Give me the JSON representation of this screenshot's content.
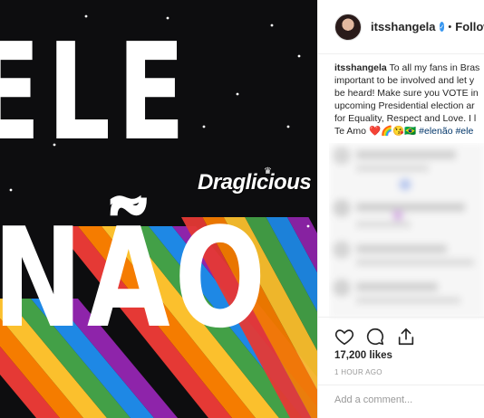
{
  "post_image": {
    "line1": "ELE",
    "line2": "NÃO",
    "tilde": "~",
    "watermark": "Draglicious",
    "crown_icon": "crown-icon",
    "background": "#0d0d0f",
    "stripe_colors": [
      "#e53935",
      "#f57c00",
      "#fbc02d",
      "#43a047",
      "#1e88e5",
      "#8e24aa"
    ]
  },
  "header": {
    "avatar_icon": "avatar",
    "username": "itsshangela",
    "verified_icon": "verified-badge-icon",
    "separator": "•",
    "follow_status": "Following"
  },
  "caption": {
    "username": "itsshangela",
    "lines": [
      "To all my fans in Bras",
      "important to be involved and let y",
      "be heard! Make sure you VOTE in",
      "upcoming Presidential election ar",
      "for Equality, Respect and Love. I l"
    ],
    "last_line_prefix": "Te Amo",
    "emojis": "❤️🌈😘🇧🇷",
    "hashtag1": "#elenão",
    "hashtag2": "#ele"
  },
  "actions": {
    "like_icon": "heart-icon",
    "comment_icon": "comment-icon",
    "share_icon": "share-icon"
  },
  "likes": "17,200 likes",
  "timestamp": "1 HOUR AGO",
  "comment_box": {
    "placeholder": "Add a comment..."
  }
}
